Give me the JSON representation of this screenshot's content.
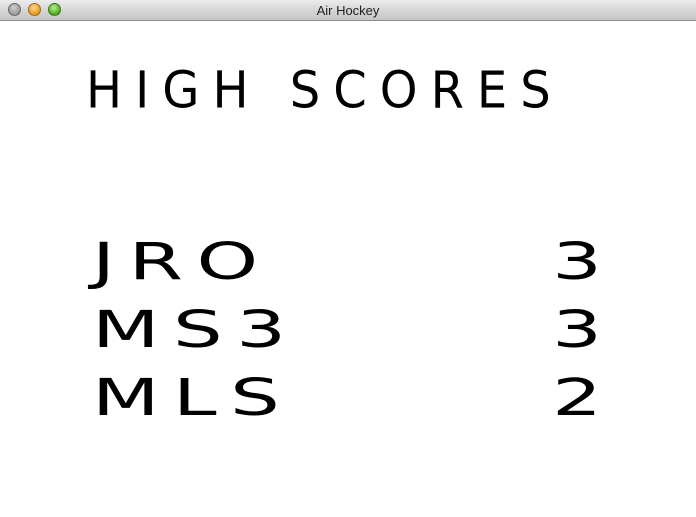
{
  "window": {
    "title": "Air Hockey"
  },
  "screen": {
    "heading": "HIGH SCORES",
    "scores": [
      {
        "name": "JRO",
        "score": "3"
      },
      {
        "name": "MS3",
        "score": "3"
      },
      {
        "name": "MLS",
        "score": "2"
      }
    ]
  },
  "colors": {
    "background": "#ffffff",
    "text": "#000000"
  }
}
